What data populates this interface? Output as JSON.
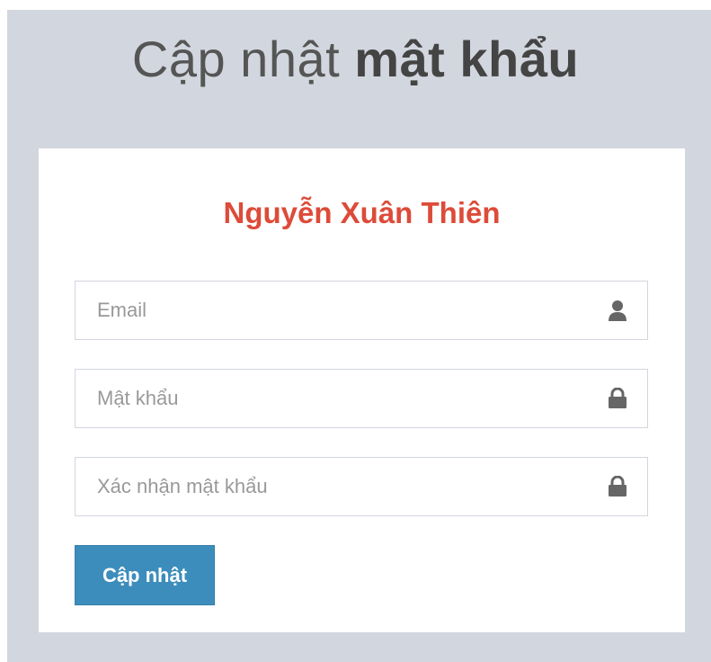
{
  "header": {
    "title_light": "Cập nhật",
    "title_bold": "mật khẩu"
  },
  "form": {
    "user_name": "Nguyễn Xuân Thiên",
    "email": {
      "placeholder": "Email",
      "value": "",
      "icon": "user-icon"
    },
    "password": {
      "placeholder": "Mật khẩu",
      "value": "",
      "icon": "lock-icon"
    },
    "confirm_password": {
      "placeholder": "Xác nhận mật khẩu",
      "value": "",
      "icon": "lock-icon"
    },
    "submit_label": "Cập nhật"
  },
  "colors": {
    "background": "#d2d6de",
    "card": "#ffffff",
    "name_accent": "#dd4b39",
    "button": "#3c8dbc",
    "icon": "#666666"
  }
}
